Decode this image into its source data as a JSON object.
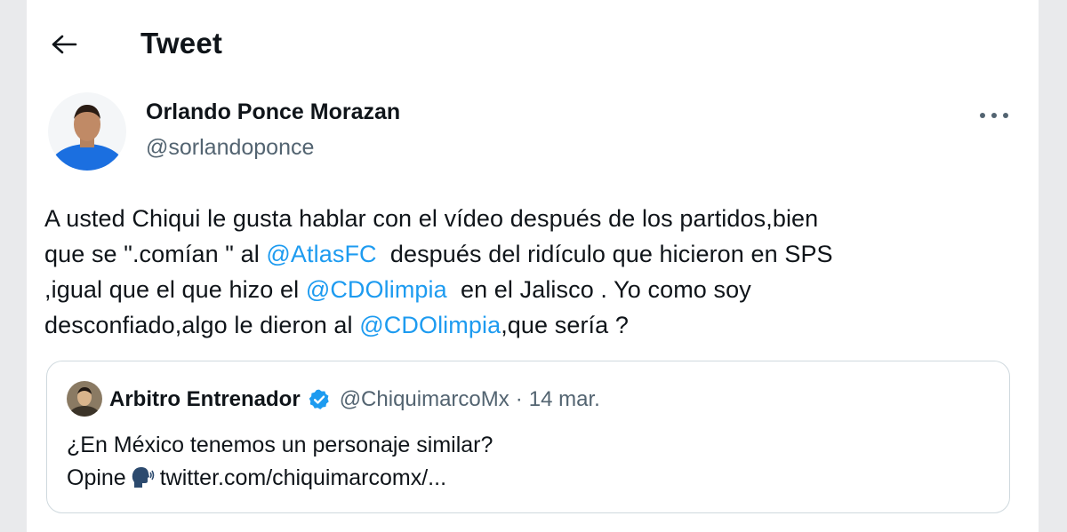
{
  "header": {
    "title": "Tweet",
    "back_icon": "back-arrow-icon"
  },
  "author": {
    "name": "Orlando Ponce Morazan",
    "handle": "@sorlandoponce",
    "more_icon": "more-options-icon"
  },
  "tweet": {
    "line1": "A usted Chiqui le gusta hablar con el vídeo después de los partidos,bien",
    "line2_a": "que se \".comían \" al ",
    "line2_mention": "@AtlasFC",
    "line2_b": "  después del ridículo que hicieron en SPS",
    "line3_a": ",igual que el que hizo el ",
    "line3_mention": "@CDOlimpia",
    "line3_b": "  en el Jalisco . Yo como soy",
    "line4_a": "desconfiado,algo le dieron al ",
    "line4_mention": "@CDOlimpia",
    "line4_b": ",que sería ?"
  },
  "quote": {
    "name": "Arbitro Entrenador",
    "handle": "@ChiquimarcoMx",
    "separator": "·",
    "date": "14 mar.",
    "line1": "¿En México tenemos un personaje similar?",
    "line2_a": "Opine",
    "line2_b": "twitter.com/chiquimarcomx/...",
    "verified_color": "#1d9bf0"
  },
  "colors": {
    "link": "#1d9bf0",
    "secondary_text": "#536471",
    "border": "#cfd9de"
  }
}
